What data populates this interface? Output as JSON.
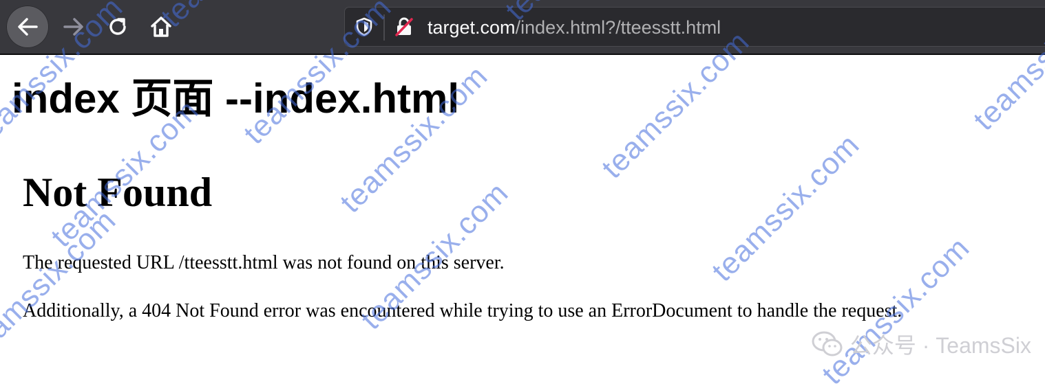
{
  "browser": {
    "nav": {
      "back": "back-arrow-icon",
      "forward": "forward-arrow-icon",
      "reload": "reload-icon",
      "home": "home-icon"
    },
    "url": {
      "host": "target.com",
      "path": "/index.html?/tteesstt.html"
    },
    "colors": {
      "toolbar": "#38383d",
      "urlbar": "#2a2a2e",
      "insecure_slash": "#e22850"
    }
  },
  "page": {
    "outer_title": "index 页面 --index.html",
    "error_heading": "Not Found",
    "error_message": "The requested URL /tteesstt.html was not found on this server.",
    "error_additional": "Additionally, a 404 Not Found error was encountered while trying to use an ErrorDocument to handle the request."
  },
  "watermark": {
    "text": "teamssix.com",
    "brand": "公众号 · TeamsSix"
  }
}
